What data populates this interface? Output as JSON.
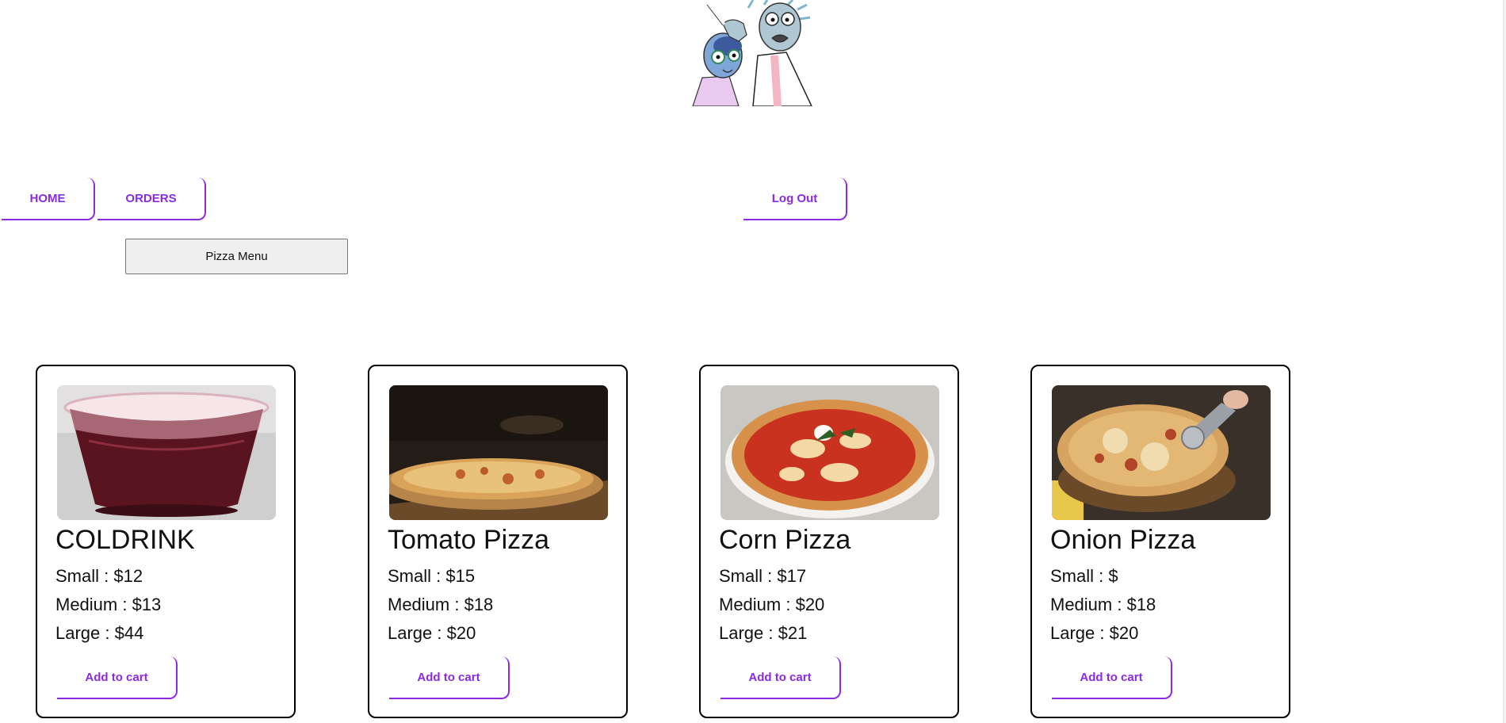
{
  "nav": {
    "home_label": "HOME",
    "orders_label": "ORDERS",
    "logout_label": "Log Out"
  },
  "menu_button_label": "Pizza Menu",
  "accent_color": "#8a2be2",
  "products": [
    {
      "name": "COLDRINK",
      "small": "Small : $12",
      "medium": "Medium : $13",
      "large": "Large : $44",
      "button": "Add to cart"
    },
    {
      "name": "Tomato Pizza",
      "small": "Small : $15",
      "medium": "Medium : $18",
      "large": "Large : $20",
      "button": "Add to cart"
    },
    {
      "name": "Corn Pizza",
      "small": "Small : $17",
      "medium": "Medium : $20",
      "large": "Large : $21",
      "button": "Add to cart"
    },
    {
      "name": "Onion Pizza",
      "small": "Small : $",
      "medium": "Medium : $18",
      "large": "Large : $20",
      "button": "Add to cart"
    }
  ]
}
